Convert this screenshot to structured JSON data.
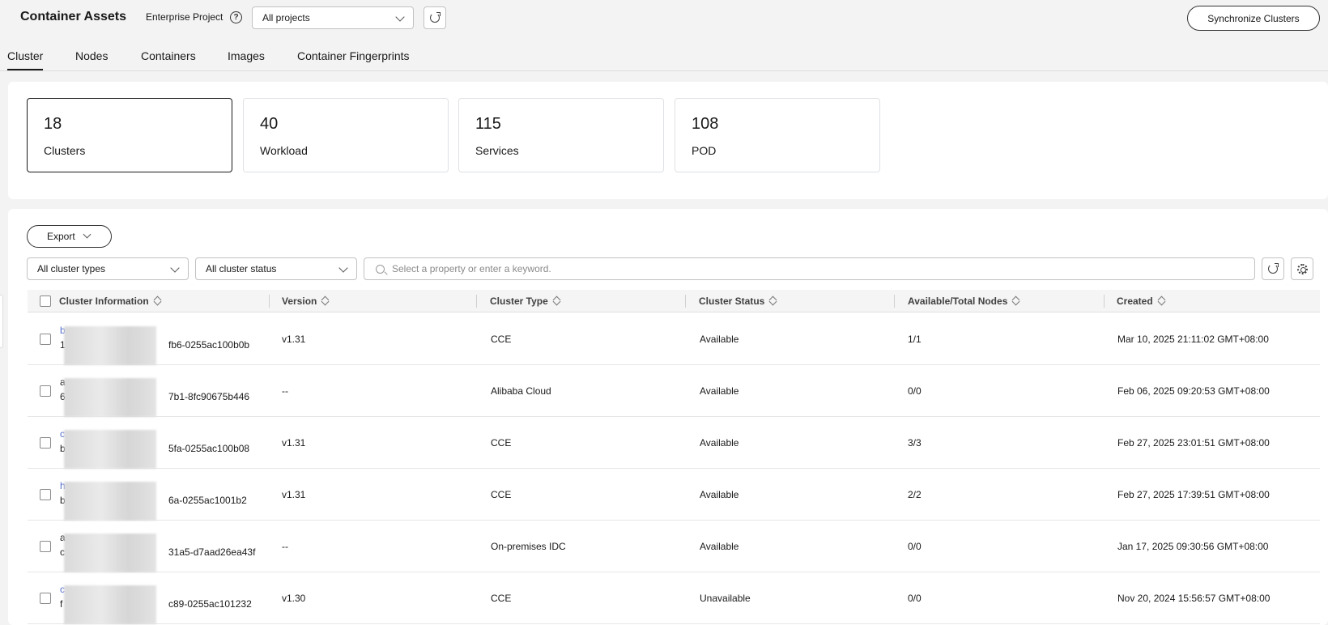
{
  "header": {
    "title": "Container Assets",
    "enterprise_label": "Enterprise Project",
    "project_select": "All projects",
    "sync_button": "Synchronize Clusters"
  },
  "tabs": [
    "Cluster",
    "Nodes",
    "Containers",
    "Images",
    "Container Fingerprints"
  ],
  "stats": [
    {
      "value": "18",
      "label": "Clusters"
    },
    {
      "value": "40",
      "label": "Workload"
    },
    {
      "value": "115",
      "label": "Services"
    },
    {
      "value": "108",
      "label": "POD"
    }
  ],
  "toolbar": {
    "export_label": "Export",
    "type_filter": "All cluster types",
    "status_filter": "All cluster status",
    "search_placeholder": "Select a property or enter a keyword."
  },
  "columns": [
    "Cluster Information",
    "Version",
    "Cluster Type",
    "Cluster Status",
    "Available/Total Nodes",
    "Created"
  ],
  "rows": [
    {
      "name": "b",
      "id": "1",
      "id_tail": "fb6-0255ac100b0b",
      "version": "v1.31",
      "type": "CCE",
      "status": "Available",
      "nodes": "1/1",
      "created": "Mar 10, 2025 21:11:02 GMT+08:00"
    },
    {
      "name": "a",
      "id": "6",
      "id_tail": "7b1-8fc90675b446",
      "version": "--",
      "type": "Alibaba Cloud",
      "status": "Available",
      "nodes": "0/0",
      "created": "Feb 06, 2025 09:20:53 GMT+08:00"
    },
    {
      "name": "c",
      "id": "b",
      "id_tail": "5fa-0255ac100b08",
      "version": "v1.31",
      "type": "CCE",
      "status": "Available",
      "nodes": "3/3",
      "created": "Feb 27, 2025 23:01:51 GMT+08:00"
    },
    {
      "name": "h",
      "id": "b",
      "id_tail": "6a-0255ac1001b2",
      "version": "v1.31",
      "type": "CCE",
      "status": "Available",
      "nodes": "2/2",
      "created": "Feb 27, 2025 17:39:51 GMT+08:00"
    },
    {
      "name": "a",
      "id": "c",
      "id_tail": "31a5-d7aad26ea43f",
      "version": "--",
      "type": "On-premises IDC",
      "status": "Available",
      "nodes": "0/0",
      "created": "Jan 17, 2025 09:30:56 GMT+08:00"
    },
    {
      "name": "c",
      "id": "f",
      "id_tail": "c89-0255ac101232",
      "version": "v1.30",
      "type": "CCE",
      "status": "Unavailable",
      "nodes": "0/0",
      "created": "Nov 20, 2024 15:56:57 GMT+08:00"
    }
  ]
}
